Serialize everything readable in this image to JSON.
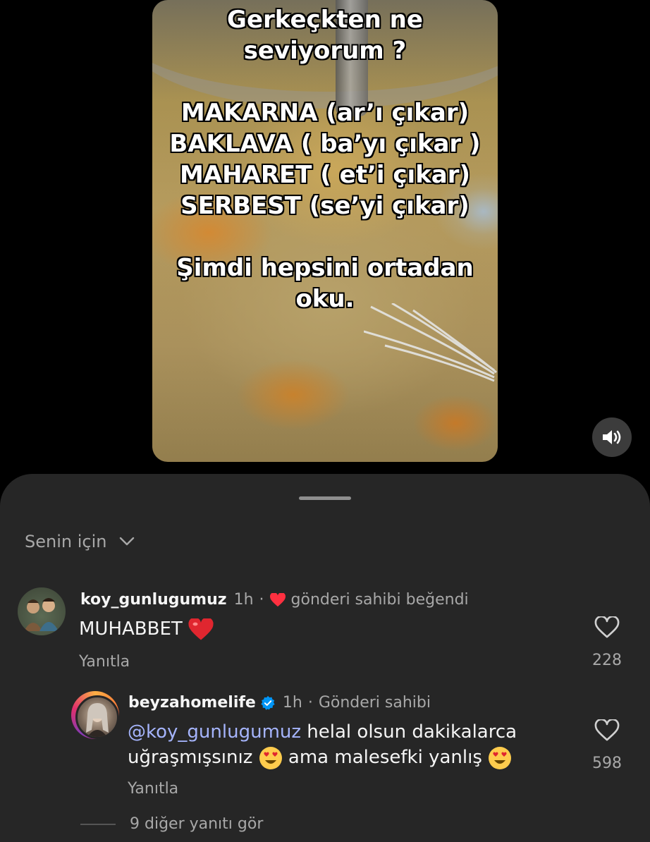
{
  "video": {
    "overlay_lines": [
      "Gerkeçkten ne",
      "seviyorum ?",
      "",
      "MAKARNA (ar’ı çıkar)",
      "BAKLAVA ( ba’yı çıkar )",
      "MAHARET ( et’i çıkar)",
      "SERBEST (se’yi çıkar)",
      "",
      "Şimdi hepsini ortadan",
      "oku."
    ],
    "sound_icon": "speaker-on-icon"
  },
  "sheet": {
    "filter_label": "Senin için",
    "comments": [
      {
        "username": "koy_gunlugumuz",
        "time": "1h",
        "liked_by_author_label": "gönderi sahibi beğendi",
        "text": "MUHABBET",
        "text_emoji": "red-heart-emoji",
        "reply_label": "Yanıtla",
        "like_count": "228"
      },
      {
        "username": "beyzahomelife",
        "verified": true,
        "time": "1h",
        "author_label": "Gönderi sahibi",
        "mention": "@koy_gunlugumuz",
        "text_part1": " helal olsun dakikalarca",
        "text_part2": "uğraşmışsınız",
        "text_part3": " ama malesefki yanlış",
        "text_emoji": "heart-eyes-emoji",
        "reply_label": "Yanıtla",
        "like_count": "598"
      }
    ],
    "more_replies_label": "9 diğer yanıtı gör"
  },
  "colors": {
    "background": "#000000",
    "sheet": "#262626",
    "muted_text": "#a8a8a8",
    "mention": "#a5b4fc",
    "like_red": "#ff3040",
    "verified_blue": "#0095f6"
  }
}
